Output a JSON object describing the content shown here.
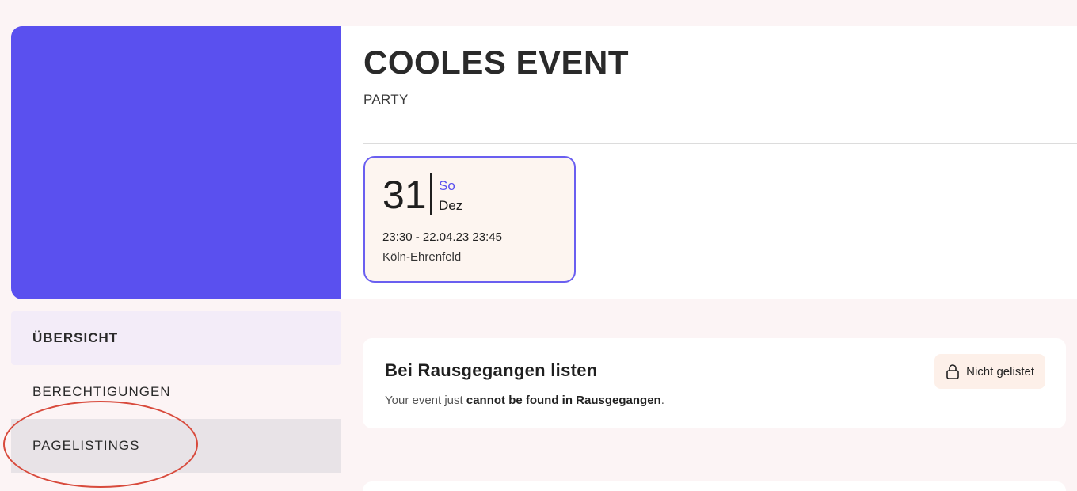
{
  "event": {
    "title": "COOLES EVENT",
    "category": "PARTY",
    "day": "31",
    "weekday": "So",
    "month": "Dez",
    "time_range": "23:30 - 22.04.23 23:45",
    "location": "Köln-Ehrenfeld",
    "banner_color": "#5a50ef"
  },
  "nav": {
    "items": [
      {
        "label": "ÜBERSICHT"
      },
      {
        "label": "BERECHTIGUNGEN"
      },
      {
        "label": "PAGELISTINGS"
      }
    ]
  },
  "listing": {
    "title": "Bei Rausgegangen listen",
    "desc_prefix": "Your event just ",
    "desc_bold_1": "cannot be found in Rausgegangen",
    "desc_suffix": ".",
    "status": "Nicht gelistet",
    "status_icon": "lock-icon"
  },
  "annotation": {
    "highlight_color": "#d84a3c"
  }
}
